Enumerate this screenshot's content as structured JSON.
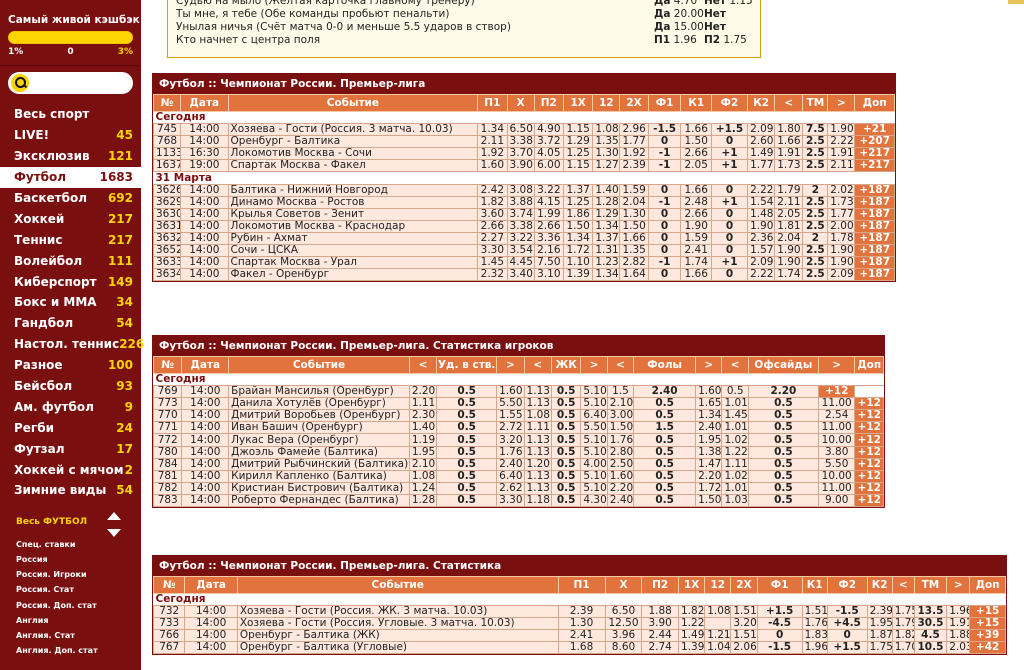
{
  "cashback": {
    "title": "Самый живой кэшбэк",
    "min": "1%",
    "mid": "0",
    "max": "3%"
  },
  "menu": [
    {
      "label": "Весь спорт",
      "count": ""
    },
    {
      "label": "LIVE!",
      "count": "45"
    },
    {
      "label": "Эксклюзив",
      "count": "121"
    },
    {
      "label": "Футбол",
      "count": "1683"
    },
    {
      "label": "Баскетбол",
      "count": "692"
    },
    {
      "label": "Хоккей",
      "count": "217"
    },
    {
      "label": "Теннис",
      "count": "217"
    },
    {
      "label": "Волейбол",
      "count": "111"
    },
    {
      "label": "Киберспорт",
      "count": "149"
    },
    {
      "label": "Бокс и ММА",
      "count": "34"
    },
    {
      "label": "Гандбол",
      "count": "54"
    },
    {
      "label": "Настол. теннис",
      "count": "226"
    },
    {
      "label": "Разное",
      "count": "100"
    },
    {
      "label": "Бейсбол",
      "count": "93"
    },
    {
      "label": "Ам. футбол",
      "count": "9"
    },
    {
      "label": "Регби",
      "count": "24"
    },
    {
      "label": "Футзал",
      "count": "17"
    },
    {
      "label": "Хоккей с мячом",
      "count": "2"
    },
    {
      "label": "Зимние виды",
      "count": "54"
    }
  ],
  "submenu": {
    "title": "Весь ФУТБОЛ",
    "items": [
      "Спец. ставки",
      "Россия",
      "Россия. Игроки",
      "Россия. Стат",
      "Россия. Доп. стат",
      "Англия",
      "Англия. Стат",
      "Англия. Доп. стат"
    ]
  },
  "top": [
    {
      "q": "Судью на мыло (Желтая карточка главному тренеру)",
      "a1l": "Да",
      "a1v": "4.70",
      "a2l": "Нет",
      "a2v": "1.15"
    },
    {
      "q": "Ты мне, я тебе (Обе команды пробьют пенальти)",
      "a1l": "Да",
      "a1v": "20.00",
      "a2l": "Нет",
      "a2v": ""
    },
    {
      "q": "Унылая ничья (Счёт матча 0-0 и меньше 5.5 ударов в створ)",
      "a1l": "Да",
      "a1v": "15.00",
      "a2l": "Нет",
      "a2v": ""
    },
    {
      "q": "Кто начнет с центра поля",
      "a1l": "П1",
      "a1v": "1.96",
      "a2l": "П2",
      "a2v": "1.75"
    }
  ],
  "t1": {
    "title": "Футбол :: Чемпионат России. Премьер-лига",
    "headers": [
      "№",
      "Дата",
      "Событие",
      "П1",
      "X",
      "П2",
      "1X",
      "12",
      "2X",
      "Ф1",
      "К1",
      "Ф2",
      "К2",
      "<",
      "ТМ",
      ">",
      "Доп"
    ],
    "groups": [
      {
        "day": "Сегодня",
        "rows": [
          [
            "745",
            "14:00",
            "Хозяева - Гости (Россия. 3 матча. 10.03)",
            "1.34",
            "6.50",
            "4.90",
            "1.15",
            "1.08",
            "2.96",
            "-1.5",
            "1.66",
            "+1.5",
            "2.09",
            "1.80",
            "7.5",
            "1.90",
            "+21"
          ],
          [
            "768",
            "14:00",
            "Оренбург - Балтика",
            "2.11",
            "3.38",
            "3.72",
            "1.29",
            "1.35",
            "1.77",
            "0",
            "1.50",
            "0",
            "2.60",
            "1.66",
            "2.5",
            "2.22",
            "+207"
          ],
          [
            "1133",
            "16:30",
            "Локомотив Москва - Сочи",
            "1.92",
            "3.70",
            "4.05",
            "1.25",
            "1.30",
            "1.92",
            "-1",
            "2.66",
            "+1",
            "1.49",
            "1.91",
            "2.5",
            "1.91",
            "+217"
          ],
          [
            "1637",
            "19:00",
            "Спартак Москва - Факел",
            "1.60",
            "3.90",
            "6.00",
            "1.15",
            "1.27",
            "2.39",
            "-1",
            "2.05",
            "+1",
            "1.77",
            "1.73",
            "2.5",
            "2.11",
            "+217"
          ]
        ]
      },
      {
        "day": "31 Марта",
        "rows": [
          [
            "3626",
            "14:00",
            "Балтика - Нижний Новгород",
            "2.42",
            "3.08",
            "3.22",
            "1.37",
            "1.40",
            "1.59",
            "0",
            "1.66",
            "0",
            "2.22",
            "1.79",
            "2",
            "2.02",
            "+187"
          ],
          [
            "3629",
            "14:00",
            "Динамо Москва - Ростов",
            "1.82",
            "3.88",
            "4.15",
            "1.25",
            "1.28",
            "2.04",
            "-1",
            "2.48",
            "+1",
            "1.54",
            "2.11",
            "2.5",
            "1.73",
            "+187"
          ],
          [
            "3630",
            "14:00",
            "Крылья Советов - Зенит",
            "3.60",
            "3.74",
            "1.99",
            "1.86",
            "1.29",
            "1.30",
            "0",
            "2.66",
            "0",
            "1.48",
            "2.05",
            "2.5",
            "1.77",
            "+187"
          ],
          [
            "3631",
            "14:00",
            "Локомотив Москва - Краснодар",
            "2.66",
            "3.38",
            "2.66",
            "1.50",
            "1.34",
            "1.50",
            "0",
            "1.90",
            "0",
            "1.90",
            "1.81",
            "2.5",
            "2.00",
            "+187"
          ],
          [
            "3632",
            "14:00",
            "Рубин - Ахмат",
            "2.27",
            "3.22",
            "3.36",
            "1.34",
            "1.37",
            "1.66",
            "0",
            "1.59",
            "0",
            "2.36",
            "2.04",
            "2",
            "1.78",
            "+187"
          ],
          [
            "3652",
            "14:00",
            "Сочи - ЦСКА",
            "3.30",
            "3.54",
            "2.16",
            "1.72",
            "1.31",
            "1.35",
            "0",
            "2.41",
            "0",
            "1.57",
            "1.90",
            "2.5",
            "1.90",
            "+187"
          ],
          [
            "3633",
            "14:00",
            "Спартак Москва - Урал",
            "1.45",
            "4.45",
            "7.50",
            "1.10",
            "1.23",
            "2.82",
            "-1",
            "1.74",
            "+1",
            "2.09",
            "1.90",
            "2.5",
            "1.90",
            "+187"
          ],
          [
            "3634",
            "14:00",
            "Факел - Оренбург",
            "2.32",
            "3.40",
            "3.10",
            "1.39",
            "1.34",
            "1.64",
            "0",
            "1.66",
            "0",
            "2.22",
            "1.74",
            "2.5",
            "2.09",
            "+187"
          ]
        ]
      }
    ]
  },
  "t2": {
    "title": "Футбол :: Чемпионат России. Премьер-лига. Статистика игроков",
    "headers": [
      "№",
      "Дата",
      "Событие",
      "<",
      "Уд. в ств.",
      ">",
      "<",
      "ЖК",
      ">",
      "<",
      "Фолы",
      ">",
      "<",
      "Офсайды",
      ">",
      "Доп"
    ],
    "day": "Сегодня",
    "rows": [
      [
        "769",
        "14:00",
        "Брайан Мансилья (Оренбург)",
        "2.20",
        "0.5",
        "1.60",
        "1.13",
        "0.5",
        "5.10",
        "1.5",
        "2.40",
        "1.60",
        "0.5",
        "2.20",
        "+12"
      ],
      [
        "773",
        "14:00",
        "Данила Хотулёв (Оренбург)",
        "1.11",
        "0.5",
        "5.50",
        "1.13",
        "0.5",
        "5.10",
        "2.10",
        "0.5",
        "1.65",
        "1.01",
        "0.5",
        "11.00",
        "+12"
      ],
      [
        "770",
        "14:00",
        "Дмитрий Воробьев (Оренбург)",
        "2.30",
        "0.5",
        "1.55",
        "1.08",
        "0.5",
        "6.40",
        "3.00",
        "0.5",
        "1.34",
        "1.45",
        "0.5",
        "2.54",
        "+12"
      ],
      [
        "771",
        "14:00",
        "Иван Башич (Оренбург)",
        "1.40",
        "0.5",
        "2.72",
        "1.11",
        "0.5",
        "5.50",
        "1.50",
        "1.5",
        "2.40",
        "1.01",
        "0.5",
        "11.00",
        "+12"
      ],
      [
        "772",
        "14:00",
        "Лукас Вера (Оренбург)",
        "1.19",
        "0.5",
        "3.20",
        "1.13",
        "0.5",
        "5.10",
        "1.76",
        "0.5",
        "1.95",
        "1.02",
        "0.5",
        "10.00",
        "+12"
      ],
      [
        "780",
        "14:00",
        "Джоэль Фамейе (Балтика)",
        "1.95",
        "0.5",
        "1.76",
        "1.13",
        "0.5",
        "5.10",
        "2.80",
        "0.5",
        "1.38",
        "1.22",
        "0.5",
        "3.80",
        "+12"
      ],
      [
        "784",
        "14:00",
        "Дмитрий Рыбчинский (Балтика)",
        "2.10",
        "0.5",
        "2.40",
        "1.20",
        "0.5",
        "4.00",
        "2.50",
        "0.5",
        "1.47",
        "1.11",
        "0.5",
        "5.50",
        "+12"
      ],
      [
        "781",
        "14:00",
        "Кирилл Капленко (Балтика)",
        "1.08",
        "0.5",
        "6.40",
        "1.13",
        "0.5",
        "5.10",
        "1.60",
        "0.5",
        "2.20",
        "1.02",
        "0.5",
        "10.00",
        "+12"
      ],
      [
        "782",
        "14:00",
        "Кристиан Бистрович (Балтика)",
        "1.24",
        "0.5",
        "2.62",
        "1.13",
        "0.5",
        "5.10",
        "2.20",
        "0.5",
        "1.72",
        "1.01",
        "0.5",
        "11.00",
        "+12"
      ],
      [
        "783",
        "14:00",
        "Роберто Фернандес (Балтика)",
        "1.28",
        "0.5",
        "3.30",
        "1.18",
        "0.5",
        "4.30",
        "2.40",
        "0.5",
        "1.50",
        "1.03",
        "0.5",
        "9.00",
        "+12"
      ]
    ]
  },
  "t3": {
    "title": "Футбол :: Чемпионат России. Премьер-лига. Статистика",
    "headers": [
      "№",
      "Дата",
      "Событие",
      "П1",
      "X",
      "П2",
      "1X",
      "12",
      "2X",
      "Ф1",
      "К1",
      "Ф2",
      "К2",
      "<",
      "ТМ",
      ">",
      "Доп"
    ],
    "day": "Сегодня",
    "rows": [
      [
        "732",
        "14:00",
        "Хозяева - Гости (Россия. ЖК. 3 матча. 10.03)",
        "2.39",
        "6.50",
        "1.88",
        "1.82",
        "1.08",
        "1.51",
        "+1.5",
        "1.51",
        "-1.5",
        "2.39",
        "1.75",
        "13.5",
        "1.96",
        "+15"
      ],
      [
        "733",
        "14:00",
        "Хозяева - Гости (Россия. Угловые. 3 матча. 10.03)",
        "1.30",
        "12.50",
        "3.90",
        "1.22",
        "",
        "3.20",
        "-4.5",
        "1.76",
        "+4.5",
        "1.95",
        "1.79",
        "30.5",
        "1.91",
        "+15"
      ],
      [
        "766",
        "14:00",
        "Оренбург - Балтика (ЖК)",
        "2.41",
        "3.96",
        "2.44",
        "1.49",
        "1.21",
        "1.51",
        "0",
        "1.83",
        "0",
        "1.87",
        "1.82",
        "4.5",
        "1.88",
        "+39"
      ],
      [
        "767",
        "14:00",
        "Оренбург - Балтика (Угловые)",
        "1.68",
        "8.60",
        "2.74",
        "1.39",
        "1.04",
        "2.06",
        "-1.5",
        "1.96",
        "+1.5",
        "1.75",
        "1.70",
        "10.5",
        "2.03",
        "+42"
      ]
    ]
  }
}
